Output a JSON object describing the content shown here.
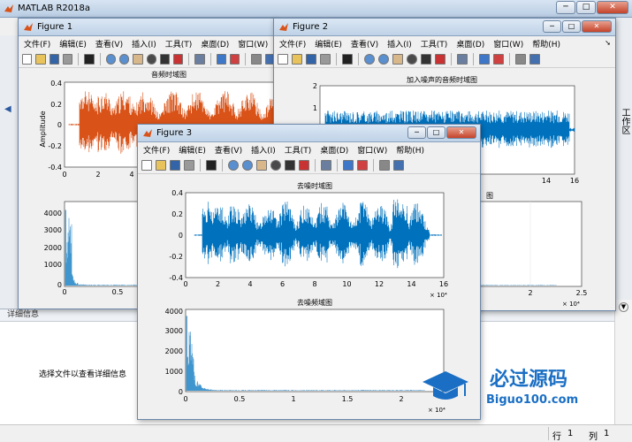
{
  "app": {
    "title": "MATLAB R2018a"
  },
  "main": {
    "right_strip_label": "工作区",
    "details_header": "详细信息",
    "details_hint": "选择文件以查看详细信息",
    "status": {
      "row_label": "行",
      "row_value": "1",
      "col_label": "列",
      "col_value": "1"
    }
  },
  "figure_menu": [
    "文件(F)",
    "编辑(E)",
    "查看(V)",
    "插入(I)",
    "工具(T)",
    "桌面(D)",
    "窗口(W)",
    "帮助(H)"
  ],
  "figure1": {
    "title": "Figure 1",
    "menu_last": "帮助",
    "top_plot": {
      "title": "音频时域图",
      "ylabel": "Amplitude",
      "yticks": [
        "0.4",
        "0.2",
        "0",
        "-0.2",
        "-0.4"
      ],
      "xticks": [
        "0",
        "2",
        "4"
      ]
    },
    "bottom_plot": {
      "yticks": [
        "4000",
        "3000",
        "2000",
        "1000",
        "0"
      ],
      "xticks": [
        "0",
        "0.5"
      ]
    }
  },
  "figure2": {
    "title": "Figure 2",
    "top_plot": {
      "title": "加入噪声的音频时域图",
      "ylabel_partial": "ude",
      "yticks": [
        "2",
        "1",
        "0",
        "-1",
        "-2"
      ],
      "xticks": [
        "14",
        "16"
      ]
    },
    "bottom_plot": {
      "title_partial": "图",
      "xticks": [
        "2",
        "2.5"
      ],
      "exponent": "× 10⁴"
    }
  },
  "figure3": {
    "title": "Figure 3",
    "top_plot": {
      "title": "去噪时域图",
      "yticks": [
        "0.4",
        "0.2",
        "0",
        "-0.2",
        "-0.4"
      ],
      "xticks": [
        "0",
        "2",
        "4",
        "6",
        "8",
        "10",
        "12",
        "14",
        "16"
      ],
      "exponent": "× 10⁴"
    },
    "bottom_plot": {
      "title": "去噪频域图",
      "yticks": [
        "4000",
        "3000",
        "2000",
        "1000",
        "0"
      ],
      "xticks": [
        "0",
        "0.5",
        "1",
        "1.5",
        "2"
      ],
      "exponent": "× 10⁴"
    }
  },
  "watermark": {
    "cn": "必过源码",
    "en": "Biguo100.com"
  },
  "colors": {
    "orange_signal": "#d95319",
    "blue_signal": "#0072bd",
    "title_gradient_top": "#dbe7f4"
  },
  "chart_data": [
    {
      "type": "line",
      "title": "音频时域图",
      "ylabel": "Amplitude",
      "ylim": [
        -0.4,
        0.4
      ],
      "xtick_labels": [
        "0",
        "2",
        "4"
      ],
      "series": [
        {
          "color": "#d95319"
        }
      ]
    },
    {
      "type": "bar",
      "ylim": [
        0,
        4000
      ],
      "xtick_labels": [
        "0",
        "0.5"
      ]
    },
    {
      "type": "line",
      "title": "加入噪声的音频时域图",
      "ylim": [
        -2,
        2
      ],
      "xtick_labels": [
        "14",
        "16"
      ],
      "series": [
        {
          "color": "#0072bd"
        }
      ]
    },
    {
      "type": "bar",
      "xtick_labels": [
        "2",
        "2.5"
      ],
      "x_exponent": "× 10⁴"
    },
    {
      "type": "line",
      "title": "去噪时域图",
      "ylim": [
        -0.4,
        0.4
      ],
      "xlim": [
        0,
        16
      ],
      "x_exponent": "× 10⁴",
      "series": [
        {
          "color": "#0072bd"
        }
      ]
    },
    {
      "type": "bar",
      "title": "去噪频域图",
      "ylim": [
        0,
        4000
      ],
      "xlim": [
        0,
        2.4
      ],
      "x_exponent": "× 10⁴",
      "series": [
        {
          "color": "#0072bd"
        }
      ]
    }
  ]
}
